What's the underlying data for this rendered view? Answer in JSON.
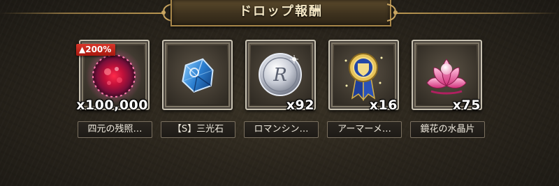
{
  "header": {
    "title": "ドロップ報酬"
  },
  "rewards": [
    {
      "name": "四元の残照…",
      "quantity": "x100,000",
      "bonus": "▲200%",
      "icon": "crimson-orb-icon"
    },
    {
      "name": "【S】三光石",
      "quantity": "",
      "icon": "blue-crystal-icon"
    },
    {
      "name": "ロマンシン…",
      "quantity": "x92",
      "icon": "silver-coin-icon"
    },
    {
      "name": "アーマーメ…",
      "quantity": "x16",
      "icon": "medal-icon"
    },
    {
      "name": "鏡花の水晶片",
      "quantity": "x75",
      "icon": "pink-lotus-icon"
    }
  ],
  "colors": {
    "background": "#2a251c",
    "frame_border": "#c9c3b3",
    "header_border": "#a8874a",
    "bonus_badge": "#c4261b",
    "quantity_text": "#ffffff"
  }
}
